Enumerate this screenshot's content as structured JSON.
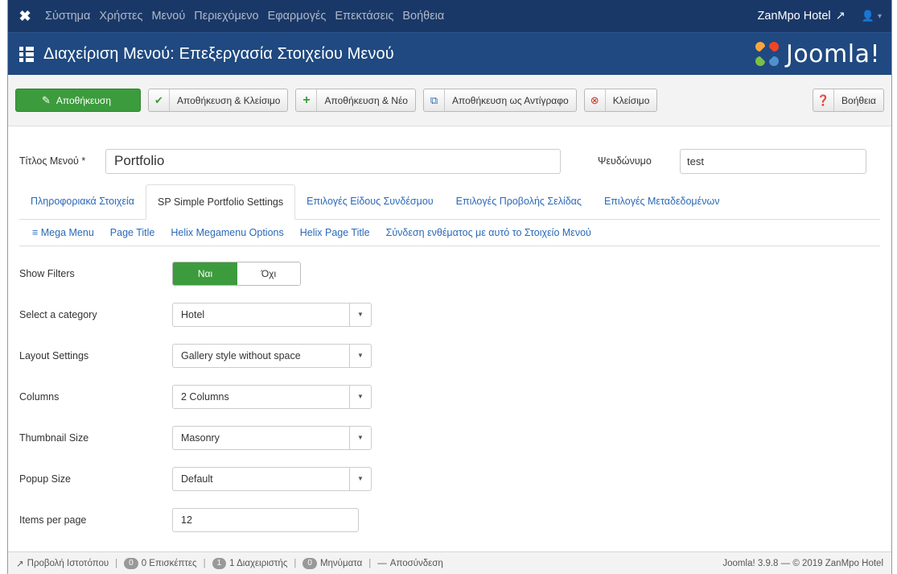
{
  "topbar": {
    "menu": [
      "Σύστημα",
      "Χρήστες",
      "Μενού",
      "Περιεχόμενο",
      "Εφαρμογές",
      "Επεκτάσεις",
      "Βοήθεια"
    ],
    "site_name": "ZanMpo Hotel"
  },
  "header": {
    "title": "Διαχείριση Μενού: Επεξεργασία Στοιχείου Μενού",
    "brand": "Joomla!"
  },
  "toolbar": {
    "save": "Αποθήκευση",
    "save_close": "Αποθήκευση & Κλείσιμο",
    "save_new": "Αποθήκευση & Νέο",
    "save_copy": "Αποθήκευση ως Αντίγραφο",
    "close": "Κλείσιμο",
    "help": "Βοήθεια"
  },
  "form_head": {
    "title_label": "Τίτλος Μενού *",
    "title_value": "Portfolio",
    "alias_label": "Ψευδώνυμο",
    "alias_value": "test"
  },
  "tabs_row1": [
    "Πληροφοριακά Στοιχεία",
    "SP Simple Portfolio Settings",
    "Επιλογές Είδους Συνδέσμου",
    "Επιλογές Προβολής Σελίδας",
    "Επιλογές Μεταδεδομένων"
  ],
  "tabs_row2": [
    "≡ Mega Menu",
    "Page Title",
    "Helix Megamenu Options",
    "Helix Page Title",
    "Σύνδεση ενθέματος με αυτό το Στοιχείο Μενού"
  ],
  "settings": {
    "show_filters": {
      "label": "Show Filters",
      "yes": "Ναι",
      "no": "Όχι"
    },
    "category": {
      "label": "Select a category",
      "value": "Hotel"
    },
    "layout": {
      "label": "Layout Settings",
      "value": "Gallery style without space"
    },
    "columns": {
      "label": "Columns",
      "value": "2 Columns"
    },
    "thumbnail": {
      "label": "Thumbnail Size",
      "value": "Masonry"
    },
    "popup": {
      "label": "Popup Size",
      "value": "Default"
    },
    "items": {
      "label": "Items per page",
      "value": "12"
    }
  },
  "status": {
    "view_site": "Προβολή Ιστοτόπου",
    "visitors_count": "0",
    "visitors": "0 Επισκέπτες",
    "admins_count": "1",
    "admins": "1 Διαχειριστής",
    "messages_count": "0",
    "messages": "Μηνύματα",
    "logout": "Αποσύνδεση",
    "version": "Joomla! 3.9.8 — © 2019 ZanMpo Hotel"
  },
  "colors": {
    "topbar": "#1a3867",
    "header": "#1f4980",
    "primary": "#3c9b3c",
    "link": "#2a69b8"
  }
}
